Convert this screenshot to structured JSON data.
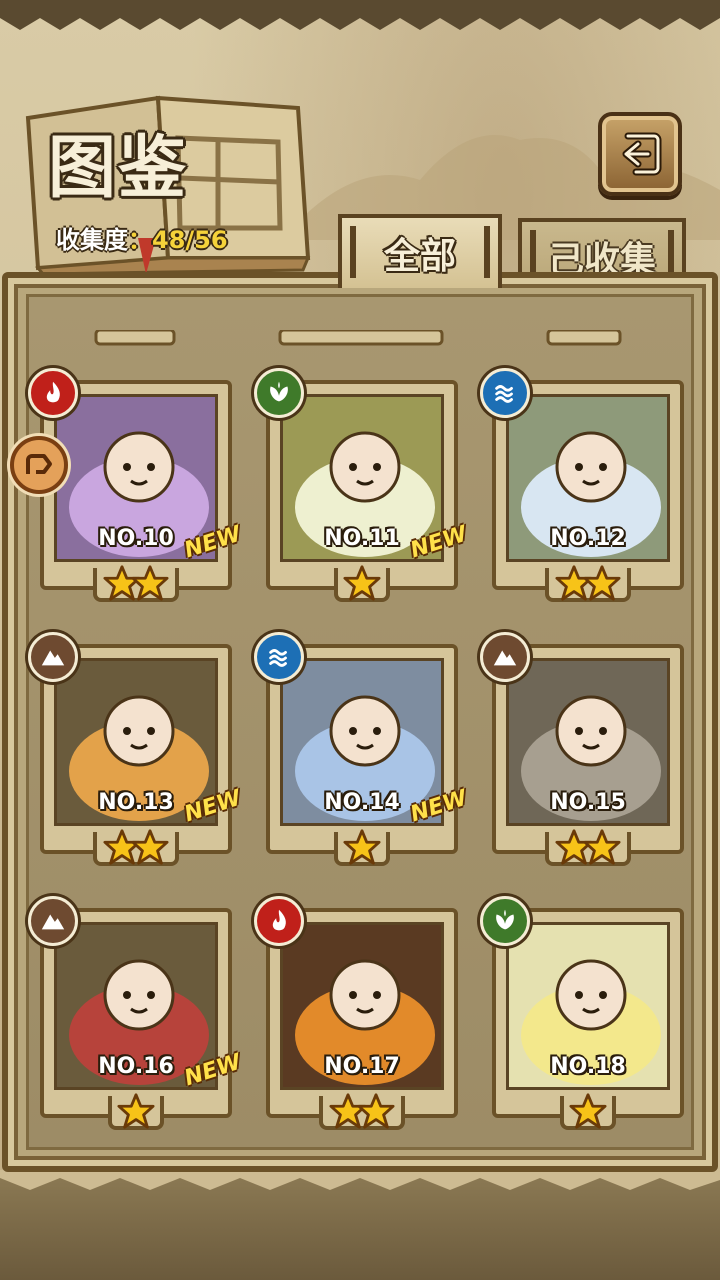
{
  "header": {
    "title": "图鉴",
    "collect_label": "收集度",
    "collect_colon": "：",
    "collect_count": "48/56"
  },
  "tabs": [
    {
      "label": "全部",
      "active": true
    },
    {
      "label": "己收集",
      "active": false
    }
  ],
  "cards": [
    {
      "no": "NO.10",
      "element": "fire",
      "stars": 2,
      "is_new": true,
      "new_label": "NEW",
      "art": "purple"
    },
    {
      "no": "NO.11",
      "element": "leaf",
      "stars": 1,
      "is_new": true,
      "new_label": "NEW",
      "art": "pale"
    },
    {
      "no": "NO.12",
      "element": "water",
      "stars": 2,
      "is_new": false,
      "art": "pale-blue"
    },
    {
      "no": "NO.13",
      "element": "earth",
      "stars": 2,
      "is_new": true,
      "new_label": "NEW",
      "art": "scarecrow"
    },
    {
      "no": "NO.14",
      "element": "water",
      "stars": 1,
      "is_new": true,
      "new_label": "NEW",
      "art": "blue-slime"
    },
    {
      "no": "NO.15",
      "element": "earth",
      "stars": 2,
      "is_new": false,
      "art": "grey-slime"
    },
    {
      "no": "NO.16",
      "element": "earth",
      "stars": 1,
      "is_new": true,
      "new_label": "NEW",
      "art": "miner"
    },
    {
      "no": "NO.17",
      "element": "fire",
      "stars": 2,
      "is_new": false,
      "art": "miner-fire"
    },
    {
      "no": "NO.18",
      "element": "leaf",
      "stars": 1,
      "is_new": false,
      "art": "flower"
    }
  ],
  "colors": {
    "fire": "#c0201a",
    "leaf": "#3f7a2a",
    "water": "#1d6fb5",
    "earth": "#6e4a30",
    "star": "#f7c318",
    "new": "#ffe14a"
  },
  "icons": {
    "back": "return-arrow-icon",
    "side_handle": "collapse-arrow-icon"
  }
}
